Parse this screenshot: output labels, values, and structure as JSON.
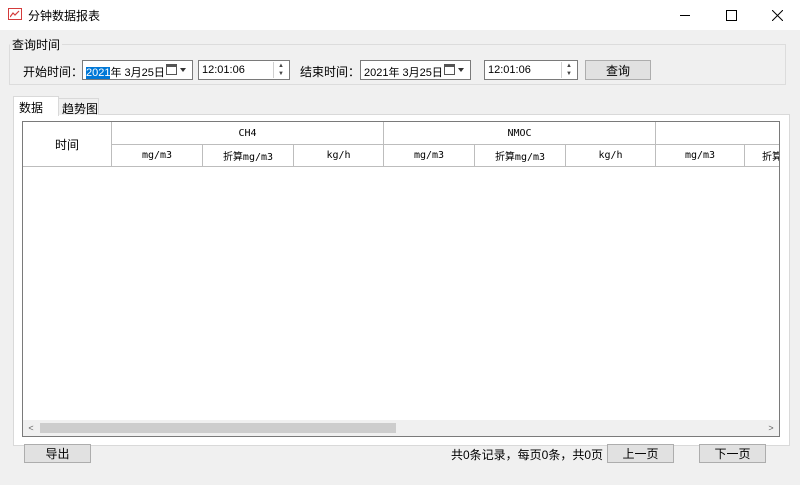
{
  "window": {
    "title": "分钟数据报表"
  },
  "query": {
    "group_label": "查询时间",
    "start_label": "开始时间：",
    "start_year": "2021",
    "start_date_rest": "年  3月25日",
    "start_time": "12:01:06",
    "end_label": "结束时间：",
    "end_date": "2021年  3月25日",
    "end_time": "12:01:06",
    "query_button": "查询"
  },
  "tabs": [
    {
      "label": "数据",
      "active": true
    },
    {
      "label": "趋势图",
      "active": false
    }
  ],
  "table": {
    "time_header": "时间",
    "groups": [
      "CH4",
      "NMOC",
      ""
    ],
    "subheaders": [
      "mg/m3",
      "折算mg/m3",
      "kg/h",
      "mg/m3",
      "折算mg/m3",
      "kg/h",
      "mg/m3",
      "折算"
    ],
    "rows": []
  },
  "footer": {
    "export_button": "导出",
    "status": "共0条记录，每页0条，共0页",
    "prev_button": "上一页",
    "next_button": "下一页"
  },
  "icons": {
    "app": "chart-icon",
    "minimize": "minimize-icon",
    "maximize": "maximize-icon",
    "close": "close-icon",
    "calendar": "calendar-dropdown-icon",
    "spin": "spin-updown-icon",
    "scroll_left": "chevron-left-icon",
    "scroll_right": "chevron-right-icon"
  }
}
